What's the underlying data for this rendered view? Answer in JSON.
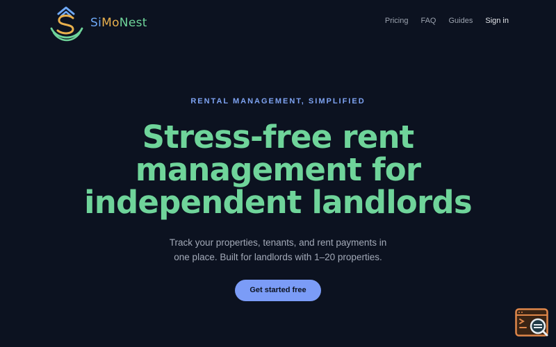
{
  "brand": {
    "name_parts": [
      {
        "text": "Si",
        "color": "#6ea8f5"
      },
      {
        "text": "Mo",
        "color": "#e9b04d"
      },
      {
        "text": "Nest",
        "color": "#6fd49a"
      }
    ]
  },
  "nav": {
    "links": [
      {
        "id": "pricing",
        "label": "Pricing"
      },
      {
        "id": "faq",
        "label": "FAQ"
      },
      {
        "id": "guides",
        "label": "Guides"
      },
      {
        "id": "signin",
        "label": "Sign in"
      }
    ]
  },
  "hero": {
    "eyebrow": "RENTAL MANAGEMENT, SIMPLIFIED",
    "headline_lines": [
      "Stress-free rent",
      "management for",
      "independent landlords"
    ],
    "sub_lines": [
      "Track your properties, tenants, and rent payments in",
      "one place. Built for landlords with 1–20 properties."
    ],
    "cta_label": "Get started free"
  },
  "colors": {
    "background": "#0c1220",
    "headline": "#6fd49a",
    "accent": "#7b9cf7",
    "eyebrow": "#7ea3f2"
  },
  "icons": {
    "logo": "house-s-logo-icon",
    "widget": "terminal-search-icon"
  }
}
